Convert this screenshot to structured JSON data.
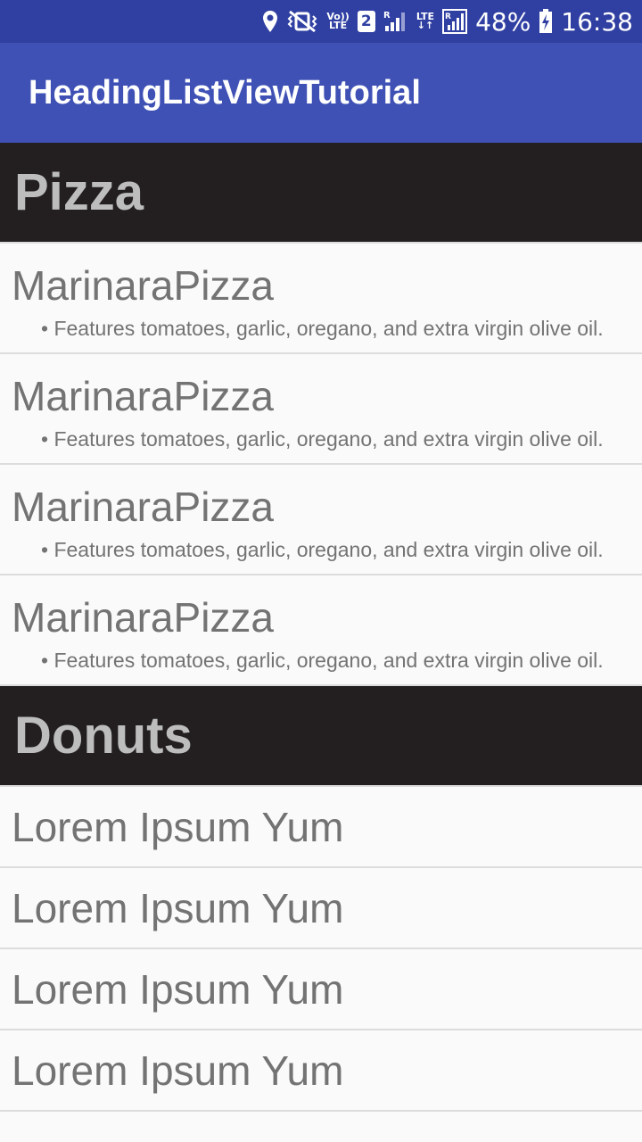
{
  "status_bar": {
    "battery_percent": "48%",
    "time": "16:38",
    "volte_top": "Vo))",
    "volte_bottom": "LTE",
    "sim_number": "2",
    "lte_label": "LTE",
    "roaming_r": "R",
    "icons": [
      "location-pin-icon",
      "vibrate-mute-icon",
      "volte-icon",
      "sim-2-icon",
      "signal-roaming-icon",
      "lte-data-icon",
      "signal-roaming-icon",
      "battery-charging-icon"
    ]
  },
  "app_bar": {
    "title": "HeadingListViewTutorial",
    "color": "#3f51b5"
  },
  "sections": [
    {
      "title": "Pizza",
      "items": [
        {
          "name": "MarinaraPizza",
          "description": "• Features tomatoes, garlic, oregano, and extra virgin olive oil."
        },
        {
          "name": "MarinaraPizza",
          "description": "• Features tomatoes, garlic, oregano, and extra virgin olive oil."
        },
        {
          "name": "MarinaraPizza",
          "description": "• Features tomatoes, garlic, oregano, and extra virgin olive oil."
        },
        {
          "name": "MarinaraPizza",
          "description": "• Features tomatoes, garlic, oregano, and extra virgin olive oil."
        }
      ]
    },
    {
      "title": "Donuts",
      "items": [
        {
          "name": "Lorem Ipsum Yum"
        },
        {
          "name": "Lorem Ipsum Yum"
        },
        {
          "name": "Lorem Ipsum Yum"
        },
        {
          "name": "Lorem Ipsum Yum"
        }
      ]
    }
  ],
  "colors": {
    "status_bar": "#3040a2",
    "header_bg": "#231f20",
    "header_text": "#bdbdbd",
    "item_text": "#737373"
  }
}
